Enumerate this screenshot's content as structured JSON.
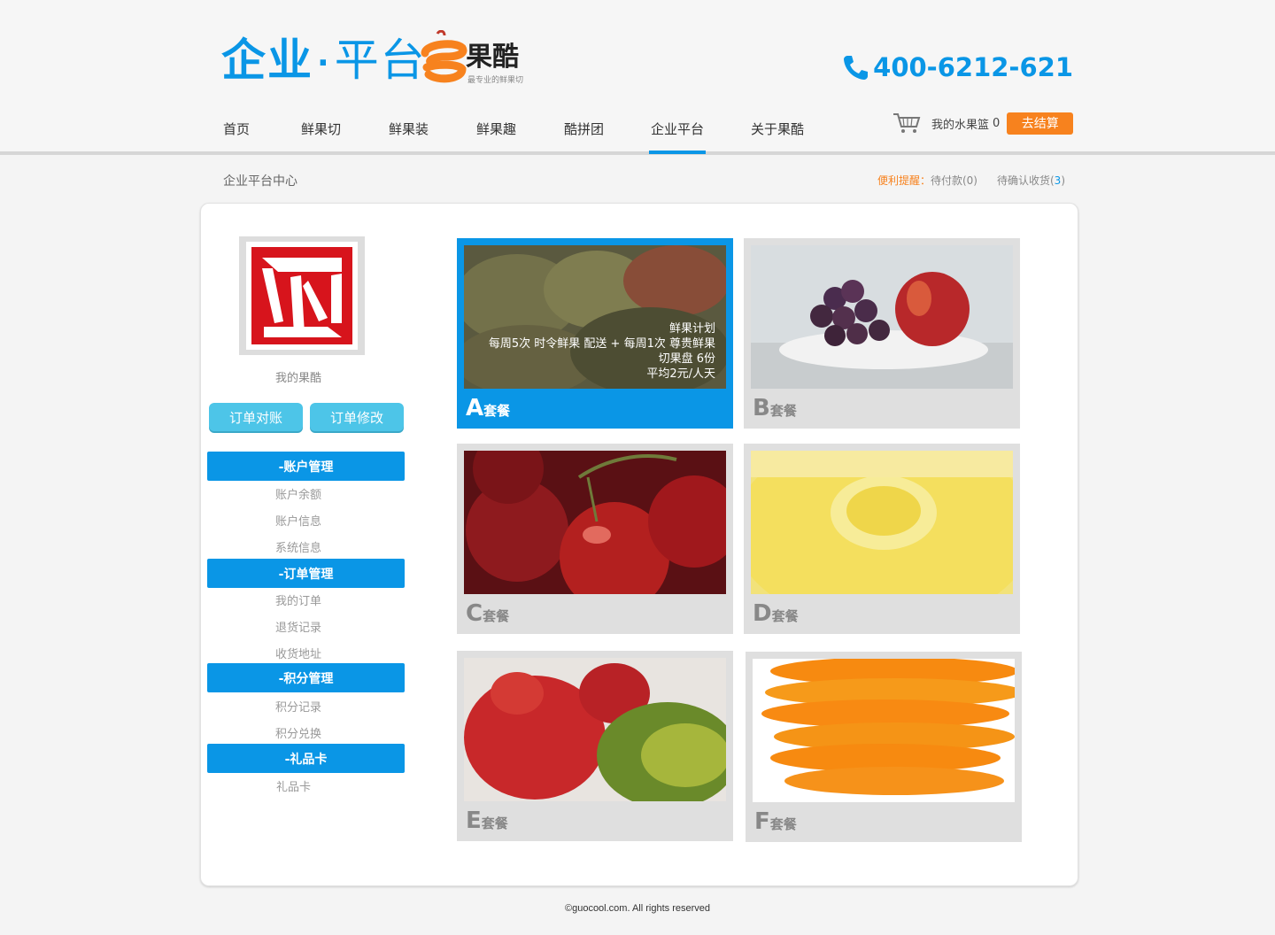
{
  "header": {
    "logo_part1": "企业",
    "logo_dot": "·",
    "logo_part2": "平台",
    "brand_name": "果酷",
    "brand_slogan": "最专业的鲜果切",
    "phone": "400-6212-621"
  },
  "nav": {
    "items": [
      "首页",
      "鲜果切",
      "鲜果装",
      "鲜果趣",
      "酷拼团",
      "企业平台",
      "关于果酷"
    ],
    "active": "企业平台"
  },
  "cart": {
    "label": "我的水果篮",
    "count": "0",
    "checkout": "去结算"
  },
  "breadcrumb": "企业平台中心",
  "reminder": {
    "prefix": "便利提醒：",
    "pending_pay": "待付款(0)",
    "pending_confirm_label": "待确认收货(",
    "pending_confirm_count": "3",
    "pending_confirm_close": ")"
  },
  "sidebar": {
    "my_label": "我的果酷",
    "buttons": [
      "订单对账",
      "订单修改"
    ],
    "sections": [
      {
        "title": "-账户管理",
        "items": [
          "账户余额",
          "账户信息",
          "系统信息"
        ]
      },
      {
        "title": "-订单管理",
        "items": [
          "我的订单",
          "退货记录",
          "收货地址"
        ]
      },
      {
        "title": "-积分管理",
        "items": [
          "积分记录",
          "积分兑换"
        ]
      },
      {
        "title": "-礼品卡",
        "items": [
          "礼品卡"
        ]
      }
    ]
  },
  "packages": [
    {
      "letter": "A",
      "suffix": "套餐",
      "overlay": [
        "鲜果计划",
        "每周5次 时令鲜果 配送 + 每周1次 尊贵鲜果",
        "切果盘 6份",
        "平均2元/人天"
      ]
    },
    {
      "letter": "B",
      "suffix": "套餐"
    },
    {
      "letter": "C",
      "suffix": "套餐"
    },
    {
      "letter": "D",
      "suffix": "套餐"
    },
    {
      "letter": "E",
      "suffix": "套餐"
    },
    {
      "letter": "F",
      "suffix": "套餐"
    }
  ],
  "footer": "©guocool.com. All rights reserved",
  "colors": {
    "accent": "#0a96e6",
    "orange": "#f7821e",
    "pill": "#4dc5e8"
  }
}
